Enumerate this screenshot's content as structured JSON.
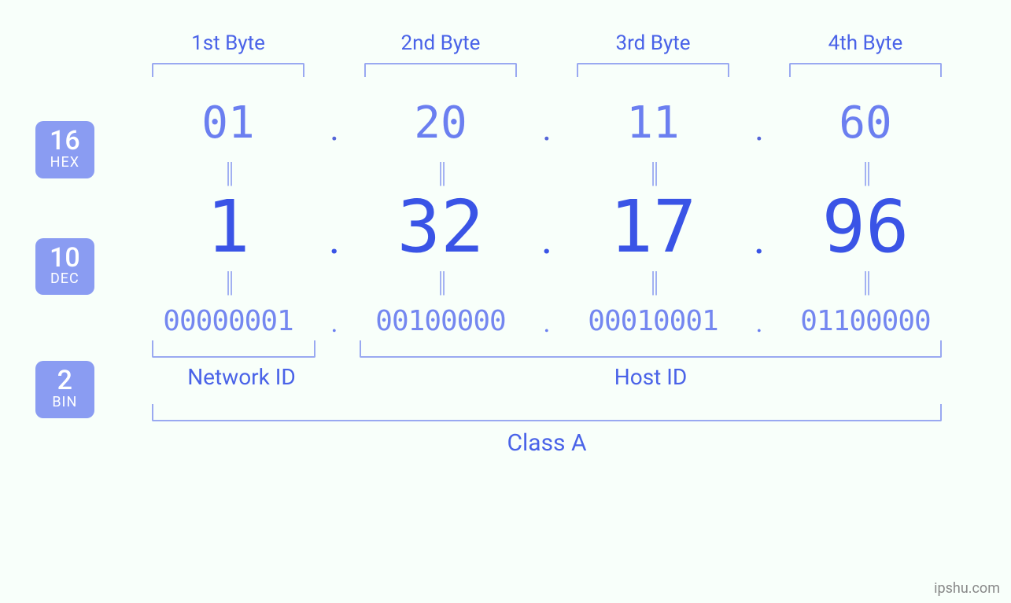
{
  "byte_headers": [
    "1st Byte",
    "2nd Byte",
    "3rd Byte",
    "4th Byte"
  ],
  "badges": {
    "hex": {
      "num": "16",
      "label": "HEX"
    },
    "dec": {
      "num": "10",
      "label": "DEC"
    },
    "bin": {
      "num": "2",
      "label": "BIN"
    }
  },
  "bytes": [
    {
      "hex": "01",
      "dec": "1",
      "bin": "00000001"
    },
    {
      "hex": "20",
      "dec": "32",
      "bin": "00100000"
    },
    {
      "hex": "11",
      "dec": "17",
      "bin": "00010001"
    },
    {
      "hex": "60",
      "dec": "96",
      "bin": "01100000"
    }
  ],
  "separator": ".",
  "equals": "||",
  "network_id_label": "Network ID",
  "host_id_label": "Host ID",
  "class_label": "Class A",
  "watermark": "ipshu.com"
}
